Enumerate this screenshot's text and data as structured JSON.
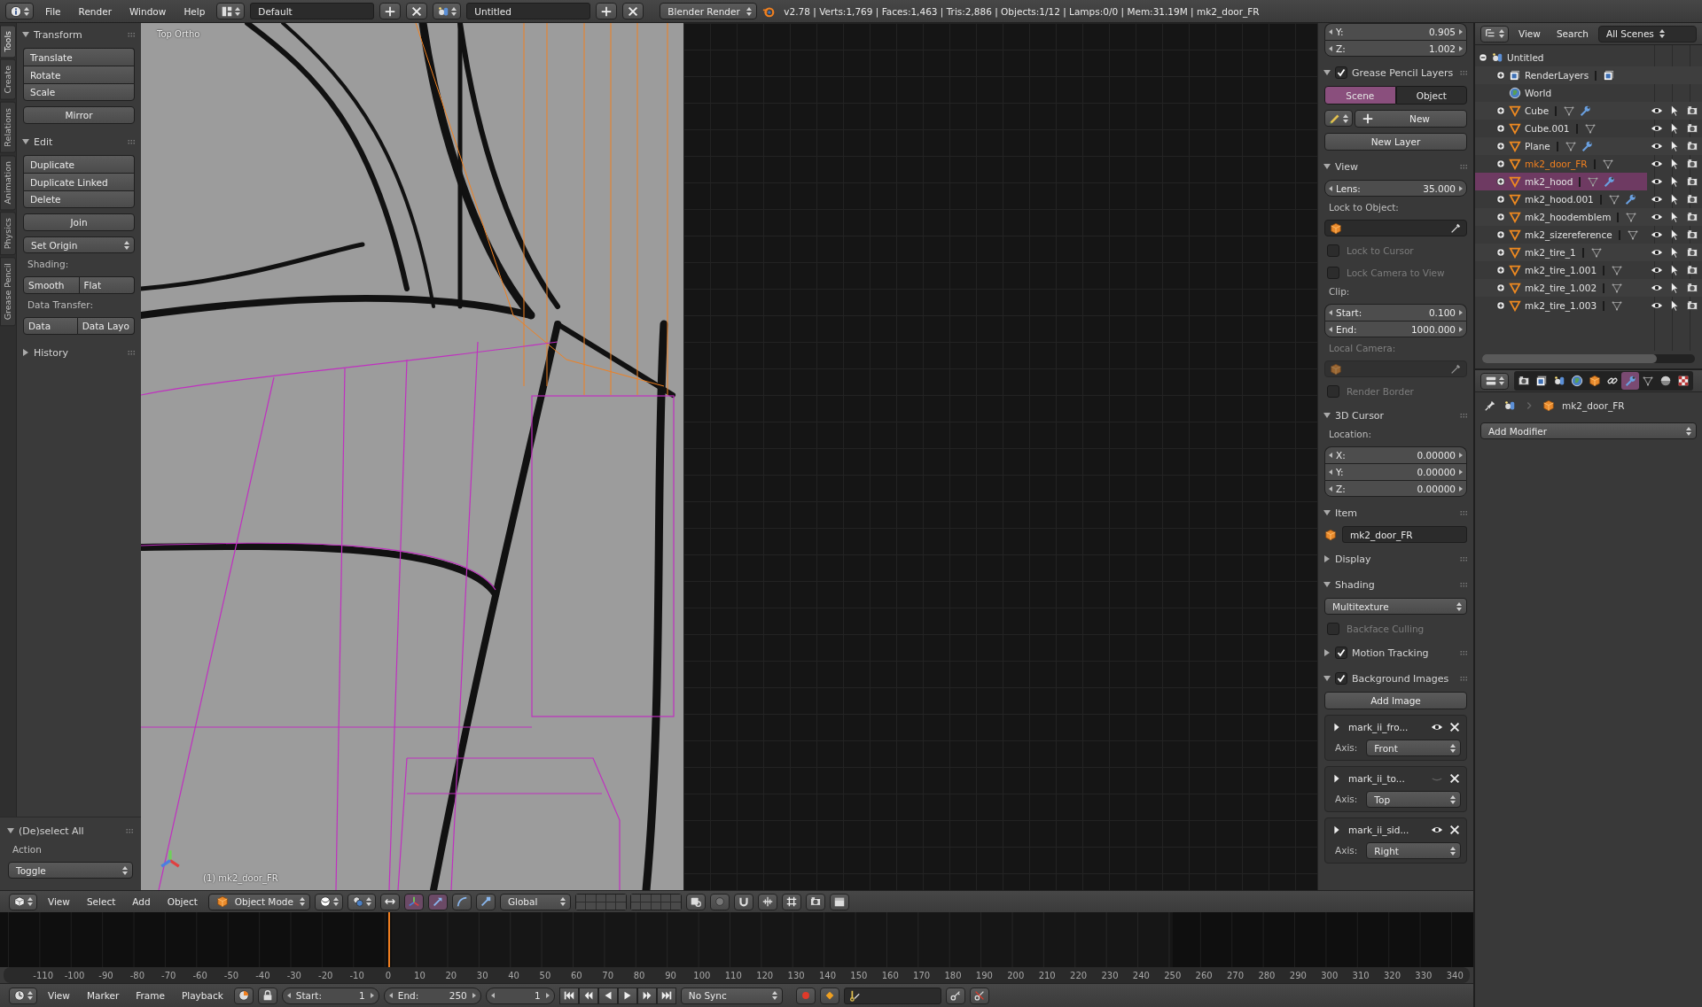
{
  "top_bar": {
    "menus": [
      "File",
      "Render",
      "Window",
      "Help"
    ],
    "screen_layout": "Default",
    "scene": "Untitled",
    "render_engine": "Blender Render",
    "stats": "v2.78 | Verts:1,769 | Faces:1,463 | Tris:2,886 | Objects:1/12 | Lamps:0/0 | Mem:31.19M | mk2_door_FR"
  },
  "tool_shelf": {
    "tabs": [
      {
        "label": "Tools",
        "selected": true
      },
      {
        "label": "Create",
        "selected": false
      },
      {
        "label": "Relations",
        "selected": false
      },
      {
        "label": "Animation",
        "selected": false
      },
      {
        "label": "Physics",
        "selected": false
      },
      {
        "label": "Grease Pencil",
        "selected": false
      }
    ],
    "panels": [
      {
        "title": "Transform",
        "expanded": true,
        "items": [
          {
            "kind": "column",
            "buttons": [
              "Translate",
              "Rotate",
              "Scale"
            ]
          },
          {
            "kind": "button",
            "label": "Mirror"
          }
        ]
      },
      {
        "title": "Edit",
        "expanded": true,
        "items": [
          {
            "kind": "column",
            "buttons": [
              "Duplicate",
              "Duplicate Linked",
              "Delete"
            ]
          },
          {
            "kind": "button",
            "label": "Join"
          },
          {
            "kind": "dropdown",
            "value": "Set Origin"
          },
          {
            "kind": "label",
            "text": "Shading:",
            "disabled": false
          },
          {
            "kind": "row",
            "buttons": [
              "Smooth",
              "Flat"
            ]
          },
          {
            "kind": "label",
            "text": "Data Transfer:",
            "disabled": false
          },
          {
            "kind": "row",
            "buttons": [
              "Data",
              "Data Layo"
            ]
          }
        ]
      },
      {
        "title": "History",
        "expanded": false
      }
    ],
    "operator": {
      "title": "(De)select All",
      "expanded": true,
      "items": [
        {
          "kind": "label",
          "text": "Action",
          "disabled": false
        },
        {
          "kind": "dropdown",
          "value": "Toggle"
        }
      ]
    }
  },
  "viewport": {
    "view_name": "Top Ortho",
    "object_info": "(1) mk2_door_FR"
  },
  "properties_region": {
    "panels": [
      {
        "items": [
          {
            "kind": "numbers",
            "fields": [
              {
                "label": "Y:",
                "value": "0.905"
              },
              {
                "label": "Z:",
                "value": "1.002"
              }
            ]
          }
        ]
      },
      {
        "title": "Grease Pencil Layers",
        "expanded": true,
        "checked": true,
        "items": [
          {
            "kind": "tabs",
            "tabs": [
              {
                "label": "Scene",
                "selected": true
              },
              {
                "label": "Object",
                "selected": false
              }
            ]
          },
          {
            "kind": "data_new",
            "label": "New"
          },
          {
            "kind": "button",
            "label": "New Layer"
          }
        ]
      },
      {
        "title": "View",
        "expanded": true,
        "items": [
          {
            "kind": "numbers",
            "fields": [
              {
                "label": "Lens:",
                "value": "35.000"
              }
            ]
          },
          {
            "kind": "label",
            "text": "Lock to Object:",
            "disabled": false
          },
          {
            "kind": "object_field",
            "disabled": false
          },
          {
            "kind": "checkbox",
            "label": "Lock to Cursor",
            "checked": false,
            "disabled": true
          },
          {
            "kind": "checkbox",
            "label": "Lock Camera to View",
            "checked": false,
            "disabled": true
          },
          {
            "kind": "label",
            "text": "Clip:",
            "disabled": false
          },
          {
            "kind": "numbers",
            "fields": [
              {
                "label": "Start:",
                "value": "0.100"
              },
              {
                "label": "End:",
                "value": "1000.000"
              }
            ]
          },
          {
            "kind": "label",
            "text": "Local Camera:",
            "disabled": true
          },
          {
            "kind": "object_field",
            "disabled": true
          },
          {
            "kind": "checkbox",
            "label": "Render Border",
            "checked": false,
            "disabled": true
          }
        ]
      },
      {
        "title": "3D Cursor",
        "expanded": true,
        "items": [
          {
            "kind": "label",
            "text": "Location:",
            "disabled": false
          },
          {
            "kind": "numbers",
            "fields": [
              {
                "label": "X:",
                "value": "0.00000"
              },
              {
                "label": "Y:",
                "value": "0.00000"
              },
              {
                "label": "Z:",
                "value": "0.00000"
              }
            ]
          }
        ]
      },
      {
        "title": "Item",
        "expanded": true,
        "items": [
          {
            "kind": "name_field",
            "value": "mk2_door_FR"
          }
        ]
      },
      {
        "title": "Display",
        "expanded": false
      },
      {
        "title": "Shading",
        "expanded": true,
        "items": [
          {
            "kind": "dropdown",
            "value": "Multitexture"
          },
          {
            "kind": "checkbox",
            "label": "Backface Culling",
            "checked": false,
            "disabled": true
          }
        ]
      },
      {
        "title": "Motion Tracking",
        "expanded": false,
        "checked": true
      },
      {
        "title": "Background Images",
        "expanded": true,
        "checked": true,
        "items": [
          {
            "kind": "button",
            "label": "Add Image"
          },
          {
            "kind": "image",
            "name": "mark_ii_fro...",
            "visible": true,
            "axis_label": "Axis:",
            "axis": "Front"
          },
          {
            "kind": "image",
            "name": "mark_ii_to...",
            "visible": false,
            "axis_label": "Axis:",
            "axis": "Top"
          },
          {
            "kind": "image",
            "name": "mark_ii_sid...",
            "visible": true,
            "axis_label": "Axis:",
            "axis": "Right"
          }
        ]
      }
    ]
  },
  "viewport_header": {
    "menus": [
      "View",
      "Select",
      "Add",
      "Object"
    ],
    "mode": "Object Mode",
    "orientation": "Global"
  },
  "timeline": {
    "ruler": [
      "-110",
      "-100",
      "-90",
      "-80",
      "-70",
      "-60",
      "-50",
      "-40",
      "-30",
      "-20",
      "-10",
      "0",
      "10",
      "20",
      "30",
      "40",
      "50",
      "60",
      "70",
      "80",
      "90",
      "100",
      "110",
      "120",
      "130",
      "140",
      "150",
      "160",
      "170",
      "180",
      "190",
      "200",
      "210",
      "220",
      "230",
      "240",
      "250",
      "260",
      "270",
      "280",
      "290",
      "300",
      "310",
      "320",
      "330",
      "340"
    ],
    "menus": [
      "View",
      "Marker",
      "Frame",
      "Playback"
    ],
    "start_label": "Start:",
    "start": "1",
    "end_label": "End:",
    "end": "250",
    "current_frame": "1",
    "sync": "No Sync"
  },
  "outliner": {
    "menus": [
      "View",
      "Search"
    ],
    "display_mode": "All Scenes",
    "tree": [
      {
        "name": "Untitled",
        "kind": "scene",
        "expanded": true,
        "selected": false,
        "active": false,
        "children": [
          {
            "name": "RenderLayers",
            "kind": "render_layers",
            "expanded": false,
            "selected": false,
            "active": false
          },
          {
            "name": "World",
            "kind": "world",
            "selected": false,
            "active": false
          },
          {
            "name": "Cube",
            "kind": "mesh_object",
            "expanded": false,
            "selected": false,
            "active": false,
            "modifier": true
          },
          {
            "name": "Cube.001",
            "kind": "mesh_object",
            "expanded": false,
            "selected": false,
            "active": false,
            "modifier": false
          },
          {
            "name": "Plane",
            "kind": "mesh_object",
            "expanded": false,
            "selected": false,
            "active": false,
            "modifier": true
          },
          {
            "name": "mk2_door_FR",
            "kind": "mesh_object",
            "expanded": false,
            "selected": false,
            "active": true,
            "modifier": false
          },
          {
            "name": "mk2_hood",
            "kind": "mesh_object",
            "expanded": false,
            "selected": true,
            "active": false,
            "modifier": true
          },
          {
            "name": "mk2_hood.001",
            "kind": "mesh_object",
            "expanded": false,
            "selected": false,
            "active": false,
            "modifier": true
          },
          {
            "name": "mk2_hoodemblem",
            "kind": "mesh_object",
            "expanded": false,
            "selected": false,
            "active": false,
            "modifier": false
          },
          {
            "name": "mk2_sizereference",
            "kind": "mesh_object",
            "expanded": false,
            "selected": false,
            "active": false,
            "modifier": false
          },
          {
            "name": "mk2_tire_1",
            "kind": "mesh_object",
            "expanded": false,
            "selected": false,
            "active": false,
            "modifier": false
          },
          {
            "name": "mk2_tire_1.001",
            "kind": "mesh_object",
            "expanded": false,
            "selected": false,
            "active": false,
            "modifier": false
          },
          {
            "name": "mk2_tire_1.002",
            "kind": "mesh_object",
            "expanded": false,
            "selected": false,
            "active": false,
            "modifier": false
          },
          {
            "name": "mk2_tire_1.003",
            "kind": "mesh_object",
            "expanded": false,
            "selected": false,
            "active": false,
            "modifier": false
          }
        ]
      }
    ]
  },
  "properties_editor": {
    "tabs": [
      {
        "kind": "render",
        "selected": false
      },
      {
        "kind": "render_layers",
        "selected": false
      },
      {
        "kind": "scene",
        "selected": false
      },
      {
        "kind": "world",
        "selected": false
      },
      {
        "kind": "object",
        "selected": false
      },
      {
        "kind": "constraints",
        "selected": false
      },
      {
        "kind": "modifiers",
        "selected": true
      },
      {
        "kind": "data",
        "selected": false
      },
      {
        "kind": "material",
        "selected": false
      },
      {
        "kind": "texture",
        "selected": false
      }
    ],
    "context": "mk2_door_FR",
    "add_modifier": "Add Modifier"
  }
}
